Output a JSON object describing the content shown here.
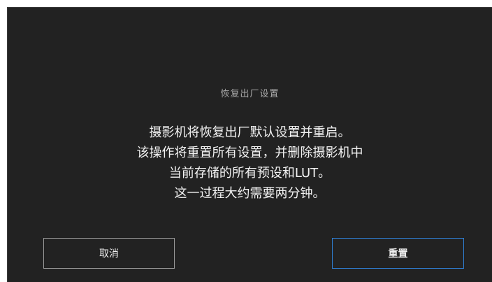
{
  "dialog": {
    "title": "恢复出厂设置",
    "message_lines": [
      "摄影机将恢复出厂默认设置并重启。",
      "该操作将重置所有设置，并删除摄影机中",
      "当前存储的所有预设和LUT。",
      "这一过程大约需要两分钟。"
    ],
    "cancel_label": "取消",
    "reset_label": "重置"
  },
  "colors": {
    "background": "#222222",
    "primary_button_border": "#2f7fd4",
    "secondary_button_border": "#9a9a9a"
  }
}
